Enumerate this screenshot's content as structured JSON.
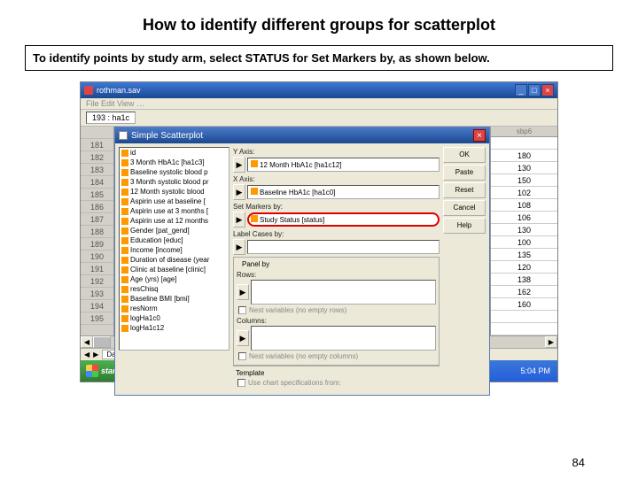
{
  "title_main": "How to identify different groups for scatterplot",
  "instruction": "To identify points by study arm, select STATUS for Set Markers by, as shown below.",
  "app_window": {
    "filename": "rothman.sav",
    "menu": "File  Edit  View  …",
    "cell_ref": "193 : ha1c"
  },
  "dialog": {
    "title": "Simple Scatterplot",
    "variables": [
      "id",
      "3 Month HbA1c [ha1c3]",
      "Baseline systolic blood p",
      "3 Month systolic blood pr",
      "12 Month systolic blood",
      "Aspirin use at baseline [",
      "Aspirin use at 3 months [",
      "Aspirin use at 12 months",
      "Gender [pat_gend]",
      "Education [educ]",
      "Income [income]",
      "Duration of disease (year",
      "Clinic at baseline [clinic]",
      "Age (yrs) [age]",
      "resChisq",
      "Baseline BMI [bmi]",
      "resNorm",
      "logHa1c0",
      "logHa1c12"
    ],
    "fields": {
      "yaxis_label": "Y Axis:",
      "yaxis_value": "12 Month HbA1c [ha1c12]",
      "xaxis_label": "X Axis:",
      "xaxis_value": "Baseline HbA1c [ha1c0]",
      "markers_label": "Set Markers by:",
      "markers_value": "Study Status [status]",
      "labelcases_label": "Label Cases by:",
      "labelcases_value": "",
      "panel_label": "Panel by",
      "rows_label": "Rows:",
      "cols_label": "Columns:",
      "nest_rows": "Nest variables (no empty rows)",
      "nest_cols": "Nest variables (no empty columns)",
      "template_label": "Template",
      "template_check": "Use chart specifications from:"
    },
    "buttons": {
      "ok": "OK",
      "paste": "Paste",
      "reset": "Reset",
      "cancel": "Cancel",
      "help": "Help"
    }
  },
  "grid": {
    "left_rows": [
      "",
      "181",
      "182",
      "183",
      "184",
      "185",
      "186",
      "187",
      "188",
      "189",
      "190",
      "191",
      "192",
      "193",
      "194",
      "195"
    ],
    "right_header": "sbp6",
    "right_vals": [
      "",
      "180",
      "130",
      "150",
      "102",
      "108",
      "106",
      "130",
      "100",
      "135",
      "120",
      "138",
      "162",
      "160",
      "",
      ""
    ]
  },
  "tab_strip": "Data View",
  "taskbar": {
    "start": "start",
    "clock": "5:04 PM"
  },
  "page_num": "84"
}
